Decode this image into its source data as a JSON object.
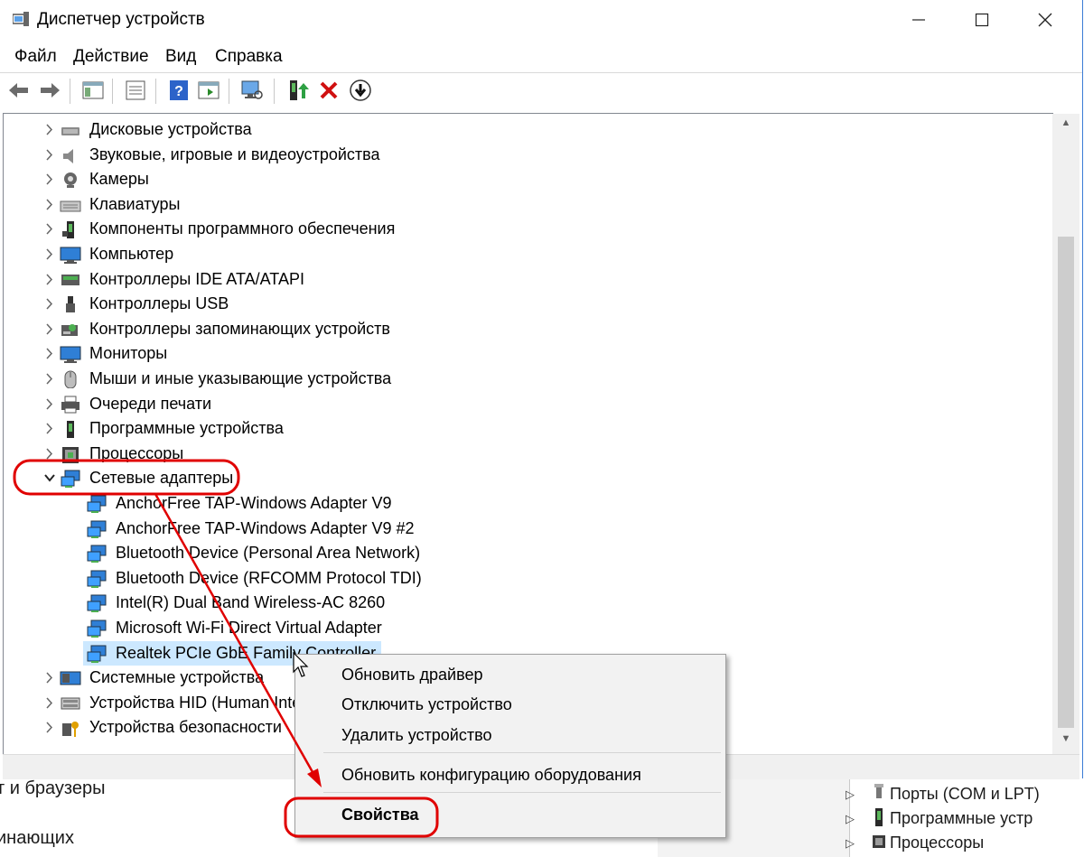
{
  "window": {
    "title": "Диспетчер устройств",
    "controls": {
      "minimize": "—",
      "maximize": "☐",
      "close": "✕"
    }
  },
  "menu": [
    "Файл",
    "Действие",
    "Вид",
    "Справка"
  ],
  "toolbar_icons": [
    "back-arrow",
    "forward-arrow",
    "show-hide-console-tree",
    "properties",
    "help",
    "action-pane",
    "scan-hardware",
    "update-driver",
    "uninstall-device",
    "disable-device"
  ],
  "tree": {
    "categories_before": [
      {
        "label": "Дисковые устройства",
        "icon": "disk-drive"
      },
      {
        "label": "Звуковые, игровые и видеоустройства",
        "icon": "speaker"
      },
      {
        "label": "Камеры",
        "icon": "webcam"
      },
      {
        "label": "Клавиатуры",
        "icon": "keyboard"
      },
      {
        "label": "Компоненты программного обеспечения",
        "icon": "software-component"
      },
      {
        "label": "Компьютер",
        "icon": "computer"
      },
      {
        "label": "Контроллеры IDE ATA/ATAPI",
        "icon": "ide-controller"
      },
      {
        "label": "Контроллеры USB",
        "icon": "usb"
      },
      {
        "label": "Контроллеры запоминающих устройств",
        "icon": "storage-controller"
      },
      {
        "label": "Мониторы",
        "icon": "monitor"
      },
      {
        "label": "Мыши и иные указывающие устройства",
        "icon": "mouse"
      },
      {
        "label": "Очереди печати",
        "icon": "printer"
      },
      {
        "label": "Программные устройства",
        "icon": "software-device"
      },
      {
        "label": "Процессоры",
        "icon": "processor"
      }
    ],
    "expanded": {
      "label": "Сетевые адаптеры",
      "icon": "network-adapter"
    },
    "children": [
      "AnchorFree TAP-Windows Adapter V9",
      "AnchorFree TAP-Windows Adapter V9 #2",
      "Bluetooth Device (Personal Area Network)",
      "Bluetooth Device (RFCOMM Protocol TDI)",
      "Intel(R) Dual Band Wireless-AC 8260",
      "Microsoft Wi-Fi Direct Virtual Adapter",
      "Realtek PCIe GbE Family Controller"
    ],
    "selected_child": "Realtek PCIe GbE Family Controller",
    "categories_after": [
      {
        "label": "Системные устройства",
        "icon": "system-device"
      },
      {
        "label": "Устройства HID (Human Inte",
        "icon": "hid-device"
      },
      {
        "label": "Устройства безопасности",
        "icon": "security-device"
      }
    ]
  },
  "context_menu": {
    "items": [
      "Обновить драйвер",
      "Отключить устройство",
      "Удалить устройство"
    ],
    "scan": "Обновить конфигурацию оборудования",
    "properties": "Свойства"
  },
  "background_window": {
    "left_lines": [
      "т и браузеры",
      "инающих"
    ],
    "right_rows": [
      "Порты (COM и LPT)",
      "Программные устр",
      "Процессоры"
    ]
  },
  "colors": {
    "selection": "#cce8ff",
    "annotation": "#e00000",
    "accent": "#3a7bd5"
  }
}
